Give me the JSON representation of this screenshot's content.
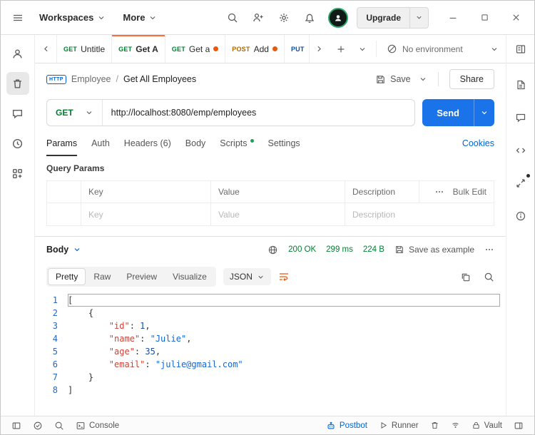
{
  "colors": {
    "accent_blue": "#0265d2",
    "send_button_blue": "#1a73e8",
    "method_get_green": "#007f31",
    "method_post_orange": "#ad6800",
    "method_put_blue": "#0053b8",
    "status_green": "#007f31",
    "unsaved_dot_orange": "#e8590c",
    "active_tab_accent": "#ff6c37"
  },
  "titlebar": {
    "workspaces_label": "Workspaces",
    "more_label": "More",
    "upgrade_label": "Upgrade"
  },
  "tabstrip": {
    "tabs": [
      {
        "method": "GET",
        "label": "Untitle"
      },
      {
        "method": "GET",
        "label": "Get A"
      },
      {
        "method": "GET",
        "label": "Get a"
      },
      {
        "method": "POST",
        "label": "Add"
      },
      {
        "method": "PUT",
        "label": ""
      }
    ],
    "environment": {
      "label": "No environment"
    }
  },
  "breadcrumb": {
    "badge": "HTTP",
    "collection": "Employee",
    "separator": "/",
    "request_name": "Get All Employees",
    "save_label": "Save",
    "share_label": "Share"
  },
  "request": {
    "method": "GET",
    "url": "http://localhost:8080/emp/employees",
    "send_label": "Send"
  },
  "request_tabs": {
    "params": "Params",
    "auth": "Auth",
    "headers": "Headers (6)",
    "body": "Body",
    "scripts": "Scripts",
    "settings": "Settings",
    "cookies_link": "Cookies"
  },
  "query_params": {
    "title": "Query Params",
    "col_key": "Key",
    "col_value": "Value",
    "col_description": "Description",
    "bulk_edit": "Bulk Edit",
    "row_placeholder_key": "Key",
    "row_placeholder_value": "Value",
    "row_placeholder_description": "Description"
  },
  "response": {
    "body_label": "Body",
    "status": "200 OK",
    "time": "299 ms",
    "size": "224 B",
    "save_as_example": "Save as example",
    "view_tabs": {
      "pretty": "Pretty",
      "raw": "Raw",
      "preview": "Preview",
      "visualize": "Visualize"
    },
    "format": "JSON",
    "editor": {
      "lines": [
        {
          "n": "1",
          "selected": true,
          "t": [
            [
              "p",
              "["
            ]
          ]
        },
        {
          "n": "2",
          "t": [
            [
              "p",
              "    {"
            ]
          ]
        },
        {
          "n": "3",
          "t": [
            [
              "p",
              "        "
            ],
            [
              "k",
              "\"id\""
            ],
            [
              "p",
              ": "
            ],
            [
              "n",
              "1"
            ],
            [
              "p",
              ","
            ]
          ]
        },
        {
          "n": "4",
          "t": [
            [
              "p",
              "        "
            ],
            [
              "k",
              "\"name\""
            ],
            [
              "p",
              ": "
            ],
            [
              "s",
              "\"Julie\""
            ],
            [
              "p",
              ","
            ]
          ]
        },
        {
          "n": "5",
          "t": [
            [
              "p",
              "        "
            ],
            [
              "k",
              "\"age\""
            ],
            [
              "p",
              ": "
            ],
            [
              "n",
              "35"
            ],
            [
              "p",
              ","
            ]
          ]
        },
        {
          "n": "6",
          "t": [
            [
              "p",
              "        "
            ],
            [
              "k",
              "\"email\""
            ],
            [
              "p",
              ": "
            ],
            [
              "s",
              "\"julie@gmail.com\""
            ]
          ]
        },
        {
          "n": "7",
          "t": [
            [
              "p",
              "    }"
            ]
          ]
        },
        {
          "n": "8",
          "t": [
            [
              "p",
              "]"
            ]
          ]
        }
      ]
    }
  },
  "statusbar": {
    "console": "Console",
    "postbot": "Postbot",
    "runner": "Runner",
    "vault": "Vault"
  }
}
